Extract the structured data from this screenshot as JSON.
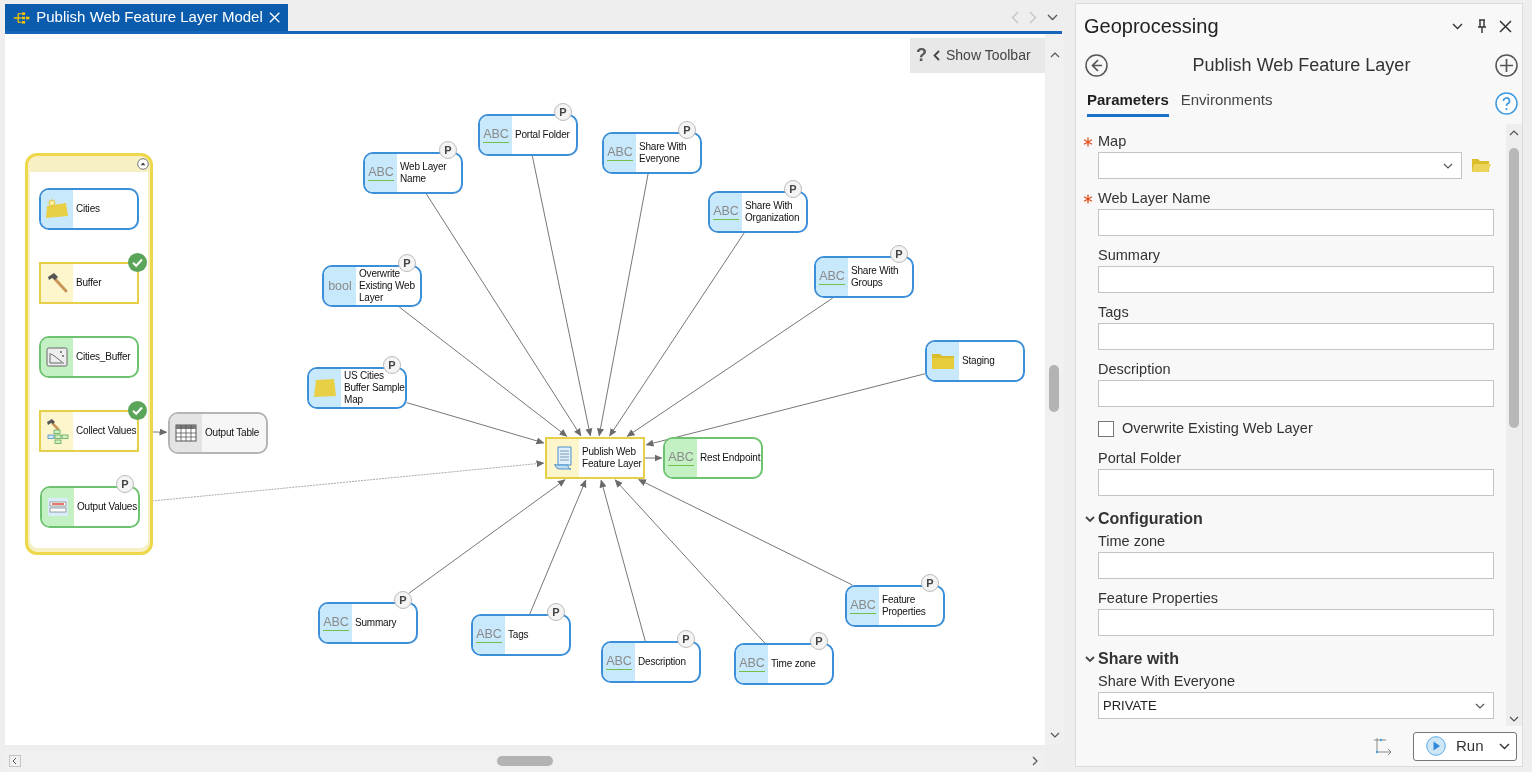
{
  "document_tab": {
    "title": "Publish Web Feature Layer Model",
    "selected": true
  },
  "toolbar": {
    "help": "?",
    "label": "Show Toolbar"
  },
  "diagram": {
    "group": {
      "expanded": true,
      "nodes": [
        {
          "label": "Cities",
          "kind": "feature_layer_variable"
        },
        {
          "label": "Buffer",
          "kind": "tool",
          "validated": true
        },
        {
          "label": "Cities_Buffer",
          "kind": "raster_derived"
        },
        {
          "label": "Collect Values",
          "kind": "collect_tool",
          "validated": true
        },
        {
          "label": "Output Values",
          "kind": "value_table_derived",
          "badge": "P"
        }
      ]
    },
    "nodes": [
      {
        "label": "Web Layer Name",
        "kind": "string_variable",
        "type_label": "ABC",
        "badge": "P"
      },
      {
        "label": "Portal Folder",
        "kind": "string_variable",
        "type_label": "ABC",
        "badge": "P"
      },
      {
        "label": "Share With Everyone",
        "kind": "string_variable",
        "type_label": "ABC",
        "badge": "P"
      },
      {
        "label": "Share With Organization",
        "kind": "string_variable",
        "type_label": "ABC",
        "badge": "P"
      },
      {
        "label": "Overwrite Existing Web Layer",
        "kind": "boolean_variable",
        "type_label": "bool",
        "badge": "P"
      },
      {
        "label": "Share With Groups",
        "kind": "string_variable",
        "type_label": "ABC",
        "badge": "P"
      },
      {
        "label": "US Cities Buffer Sample Map",
        "kind": "map_variable",
        "badge": "P"
      },
      {
        "label": "Staging",
        "kind": "folder_variable"
      },
      {
        "label": "Output Table",
        "kind": "table_output"
      },
      {
        "label": "Publish Web Feature Layer",
        "kind": "script_tool"
      },
      {
        "label": "Rest Endpoint",
        "kind": "string_derived",
        "type_label": "ABC"
      },
      {
        "label": "Summary",
        "kind": "string_variable",
        "type_label": "ABC",
        "badge": "P"
      },
      {
        "label": "Tags",
        "kind": "string_variable",
        "type_label": "ABC",
        "badge": "P"
      },
      {
        "label": "Description",
        "kind": "string_variable",
        "type_label": "ABC",
        "badge": "P"
      },
      {
        "label": "Time zone",
        "kind": "string_variable",
        "type_label": "ABC",
        "badge": "P"
      },
      {
        "label": "Feature Properties",
        "kind": "string_variable",
        "type_label": "ABC",
        "badge": "P"
      }
    ]
  },
  "panel": {
    "title": "Geoprocessing",
    "tool_title": "Publish Web Feature Layer",
    "tabs": [
      {
        "label": "Parameters",
        "selected": true
      },
      {
        "label": "Environments",
        "selected": false
      }
    ],
    "params": [
      {
        "kind": "dropdown",
        "label": "Map",
        "required": true,
        "browse": true
      },
      {
        "kind": "text",
        "label": "Web Layer Name",
        "required": true
      },
      {
        "kind": "text",
        "label": "Summary",
        "required": false
      },
      {
        "kind": "text",
        "label": "Tags",
        "required": false
      },
      {
        "kind": "text",
        "label": "Description",
        "required": false
      },
      {
        "kind": "checkbox",
        "label": "Overwrite Existing Web Layer",
        "checked": false
      },
      {
        "kind": "text",
        "label": "Portal Folder",
        "required": false
      },
      {
        "kind": "section",
        "label": "Configuration",
        "expanded": true
      },
      {
        "kind": "text",
        "label": "Time zone",
        "required": false
      },
      {
        "kind": "text",
        "label": "Feature Properties",
        "required": false
      },
      {
        "kind": "section",
        "label": "Share with",
        "expanded": true
      },
      {
        "kind": "dropdown",
        "label": "Share With Everyone",
        "required": false,
        "value": "PRIVATE"
      }
    ],
    "run_button": "Run"
  }
}
